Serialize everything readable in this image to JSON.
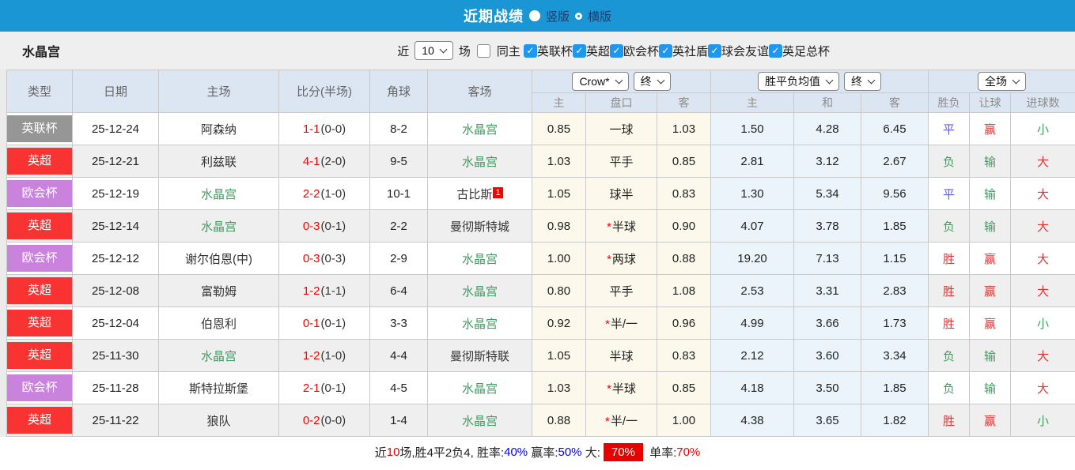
{
  "palette": {
    "titlebar_blue": "#1a96d5",
    "checkbox_blue": "#1f97ee",
    "team_green": "#3c9e5f",
    "score_red": "#ff0000",
    "badge_red": "#ff0000",
    "result_red": "#e53333",
    "result_green": "#3c9e5f",
    "result_blue": "#5a5af0",
    "type_gray": "#969696",
    "type_red": "#f93232",
    "type_purple": "#c983dc",
    "footer_blue": "#0000ee",
    "footer_red": "#e60000"
  },
  "titlebar": {
    "title": "近期战绩",
    "radio_vertical": "竖版",
    "radio_horizontal": "横版"
  },
  "filter": {
    "team": "水晶宫",
    "recent_label": "近",
    "recent_value": "10",
    "games_label": "场",
    "same_home_label": "同主",
    "same_home_checked": false,
    "competitions": [
      {
        "label": "英联杯",
        "checked": true
      },
      {
        "label": "英超",
        "checked": true
      },
      {
        "label": "欧会杯",
        "checked": true
      },
      {
        "label": "英社盾",
        "checked": true
      },
      {
        "label": "球会友谊",
        "checked": true
      },
      {
        "label": "英足总杯",
        "checked": true
      }
    ],
    "check_glyph": "✓"
  },
  "table": {
    "headers": {
      "type": "类型",
      "date": "日期",
      "home": "主场",
      "score": "比分(半场)",
      "corner": "角球",
      "away": "客场",
      "bookmaker": "Crow*",
      "ah_final": "终",
      "odds_type": "胜平负均值",
      "eu_final": "终",
      "scope": "全场",
      "sub": [
        "主",
        "盘口",
        "客",
        "主",
        "和",
        "客",
        "胜负",
        "让球",
        "进球数"
      ]
    },
    "rows": [
      {
        "type": "英联杯",
        "type_color": "type_gray",
        "date": "25-12-24",
        "home": "阿森纳",
        "home_is_team": false,
        "score": "1-1",
        "half": "(0-0)",
        "corner": "8-2",
        "away": "水晶宫",
        "away_is_team": true,
        "away_badge": "",
        "ah_home": "0.85",
        "ah_star": false,
        "ah_line": "一球",
        "ah_away": "1.03",
        "eu_home": "1.50",
        "eu_draw": "4.28",
        "eu_away": "6.45",
        "result": "平",
        "result_color": "result_blue",
        "handicap": "赢",
        "handicap_color": "result_red",
        "goals": "小",
        "goals_color": "result_green"
      },
      {
        "type": "英超",
        "type_color": "type_red",
        "date": "25-12-21",
        "home": "利兹联",
        "home_is_team": false,
        "score": "4-1",
        "half": "(2-0)",
        "corner": "9-5",
        "away": "水晶宫",
        "away_is_team": true,
        "away_badge": "",
        "ah_home": "1.03",
        "ah_star": false,
        "ah_line": "平手",
        "ah_away": "0.85",
        "eu_home": "2.81",
        "eu_draw": "3.12",
        "eu_away": "2.67",
        "result": "负",
        "result_color": "result_green",
        "handicap": "输",
        "handicap_color": "result_green",
        "goals": "大",
        "goals_color": "result_red"
      },
      {
        "type": "欧会杯",
        "type_color": "type_purple",
        "date": "25-12-19",
        "home": "水晶宫",
        "home_is_team": true,
        "score": "2-2",
        "half": "(1-0)",
        "corner": "10-1",
        "away": "古比斯",
        "away_is_team": false,
        "away_badge": "1",
        "ah_home": "1.05",
        "ah_star": false,
        "ah_line": "球半",
        "ah_away": "0.83",
        "eu_home": "1.30",
        "eu_draw": "5.34",
        "eu_away": "9.56",
        "result": "平",
        "result_color": "result_blue",
        "handicap": "输",
        "handicap_color": "result_green",
        "goals": "大",
        "goals_color": "result_red"
      },
      {
        "type": "英超",
        "type_color": "type_red",
        "date": "25-12-14",
        "home": "水晶宫",
        "home_is_team": true,
        "score": "0-3",
        "half": "(0-1)",
        "corner": "2-2",
        "away": "曼彻斯特城",
        "away_is_team": false,
        "away_badge": "",
        "ah_home": "0.98",
        "ah_star": true,
        "ah_line": "半球",
        "ah_away": "0.90",
        "eu_home": "4.07",
        "eu_draw": "3.78",
        "eu_away": "1.85",
        "result": "负",
        "result_color": "result_green",
        "handicap": "输",
        "handicap_color": "result_green",
        "goals": "大",
        "goals_color": "result_red"
      },
      {
        "type": "欧会杯",
        "type_color": "type_purple",
        "date": "25-12-12",
        "home": "谢尔伯恩(中)",
        "home_is_team": false,
        "score": "0-3",
        "half": "(0-3)",
        "corner": "2-9",
        "away": "水晶宫",
        "away_is_team": true,
        "away_badge": "",
        "ah_home": "1.00",
        "ah_star": true,
        "ah_line": "两球",
        "ah_away": "0.88",
        "eu_home": "19.20",
        "eu_draw": "7.13",
        "eu_away": "1.15",
        "result": "胜",
        "result_color": "result_red",
        "handicap": "赢",
        "handicap_color": "result_red",
        "goals": "大",
        "goals_color": "result_red"
      },
      {
        "type": "英超",
        "type_color": "type_red",
        "date": "25-12-08",
        "home": "富勒姆",
        "home_is_team": false,
        "score": "1-2",
        "half": "(1-1)",
        "corner": "6-4",
        "away": "水晶宫",
        "away_is_team": true,
        "away_badge": "",
        "ah_home": "0.80",
        "ah_star": false,
        "ah_line": "平手",
        "ah_away": "1.08",
        "eu_home": "2.53",
        "eu_draw": "3.31",
        "eu_away": "2.83",
        "result": "胜",
        "result_color": "result_red",
        "handicap": "赢",
        "handicap_color": "result_red",
        "goals": "大",
        "goals_color": "result_red"
      },
      {
        "type": "英超",
        "type_color": "type_red",
        "date": "25-12-04",
        "home": "伯恩利",
        "home_is_team": false,
        "score": "0-1",
        "half": "(0-1)",
        "corner": "3-3",
        "away": "水晶宫",
        "away_is_team": true,
        "away_badge": "",
        "ah_home": "0.92",
        "ah_star": true,
        "ah_line": "半/一",
        "ah_away": "0.96",
        "eu_home": "4.99",
        "eu_draw": "3.66",
        "eu_away": "1.73",
        "result": "胜",
        "result_color": "result_red",
        "handicap": "赢",
        "handicap_color": "result_red",
        "goals": "小",
        "goals_color": "result_green"
      },
      {
        "type": "英超",
        "type_color": "type_red",
        "date": "25-11-30",
        "home": "水晶宫",
        "home_is_team": true,
        "score": "1-2",
        "half": "(1-0)",
        "corner": "4-4",
        "away": "曼彻斯特联",
        "away_is_team": false,
        "away_badge": "",
        "ah_home": "1.05",
        "ah_star": false,
        "ah_line": "半球",
        "ah_away": "0.83",
        "eu_home": "2.12",
        "eu_draw": "3.60",
        "eu_away": "3.34",
        "result": "负",
        "result_color": "result_green",
        "handicap": "输",
        "handicap_color": "result_green",
        "goals": "大",
        "goals_color": "result_red"
      },
      {
        "type": "欧会杯",
        "type_color": "type_purple",
        "date": "25-11-28",
        "home": "斯特拉斯堡",
        "home_is_team": false,
        "score": "2-1",
        "half": "(0-1)",
        "corner": "4-5",
        "away": "水晶宫",
        "away_is_team": true,
        "away_badge": "",
        "ah_home": "1.03",
        "ah_star": true,
        "ah_line": "半球",
        "ah_away": "0.85",
        "eu_home": "4.18",
        "eu_draw": "3.50",
        "eu_away": "1.85",
        "result": "负",
        "result_color": "result_green",
        "handicap": "输",
        "handicap_color": "result_green",
        "goals": "大",
        "goals_color": "result_red"
      },
      {
        "type": "英超",
        "type_color": "type_red",
        "date": "25-11-22",
        "home": "狼队",
        "home_is_team": false,
        "score": "0-2",
        "half": "(0-0)",
        "corner": "1-4",
        "away": "水晶宫",
        "away_is_team": true,
        "away_badge": "",
        "ah_home": "0.88",
        "ah_star": true,
        "ah_line": "半/一",
        "ah_away": "1.00",
        "eu_home": "4.38",
        "eu_draw": "3.65",
        "eu_away": "1.82",
        "result": "胜",
        "result_color": "result_red",
        "handicap": "赢",
        "handicap_color": "result_red",
        "goals": "小",
        "goals_color": "result_green"
      }
    ]
  },
  "footer": {
    "segments": [
      {
        "text": "近",
        "color": "black"
      },
      {
        "text": "10",
        "color": "red"
      },
      {
        "text": "场,胜4平2负4, 胜率:",
        "color": "black"
      },
      {
        "text": "40%",
        "color": "blue"
      },
      {
        "text": " 赢率:",
        "color": "black"
      },
      {
        "text": "50%",
        "color": "blue"
      },
      {
        "text": " 大:",
        "color": "black"
      },
      {
        "text": "70%",
        "color": "badge"
      },
      {
        "text": " 单率:",
        "color": "black"
      },
      {
        "text": "70%",
        "color": "red"
      }
    ]
  }
}
